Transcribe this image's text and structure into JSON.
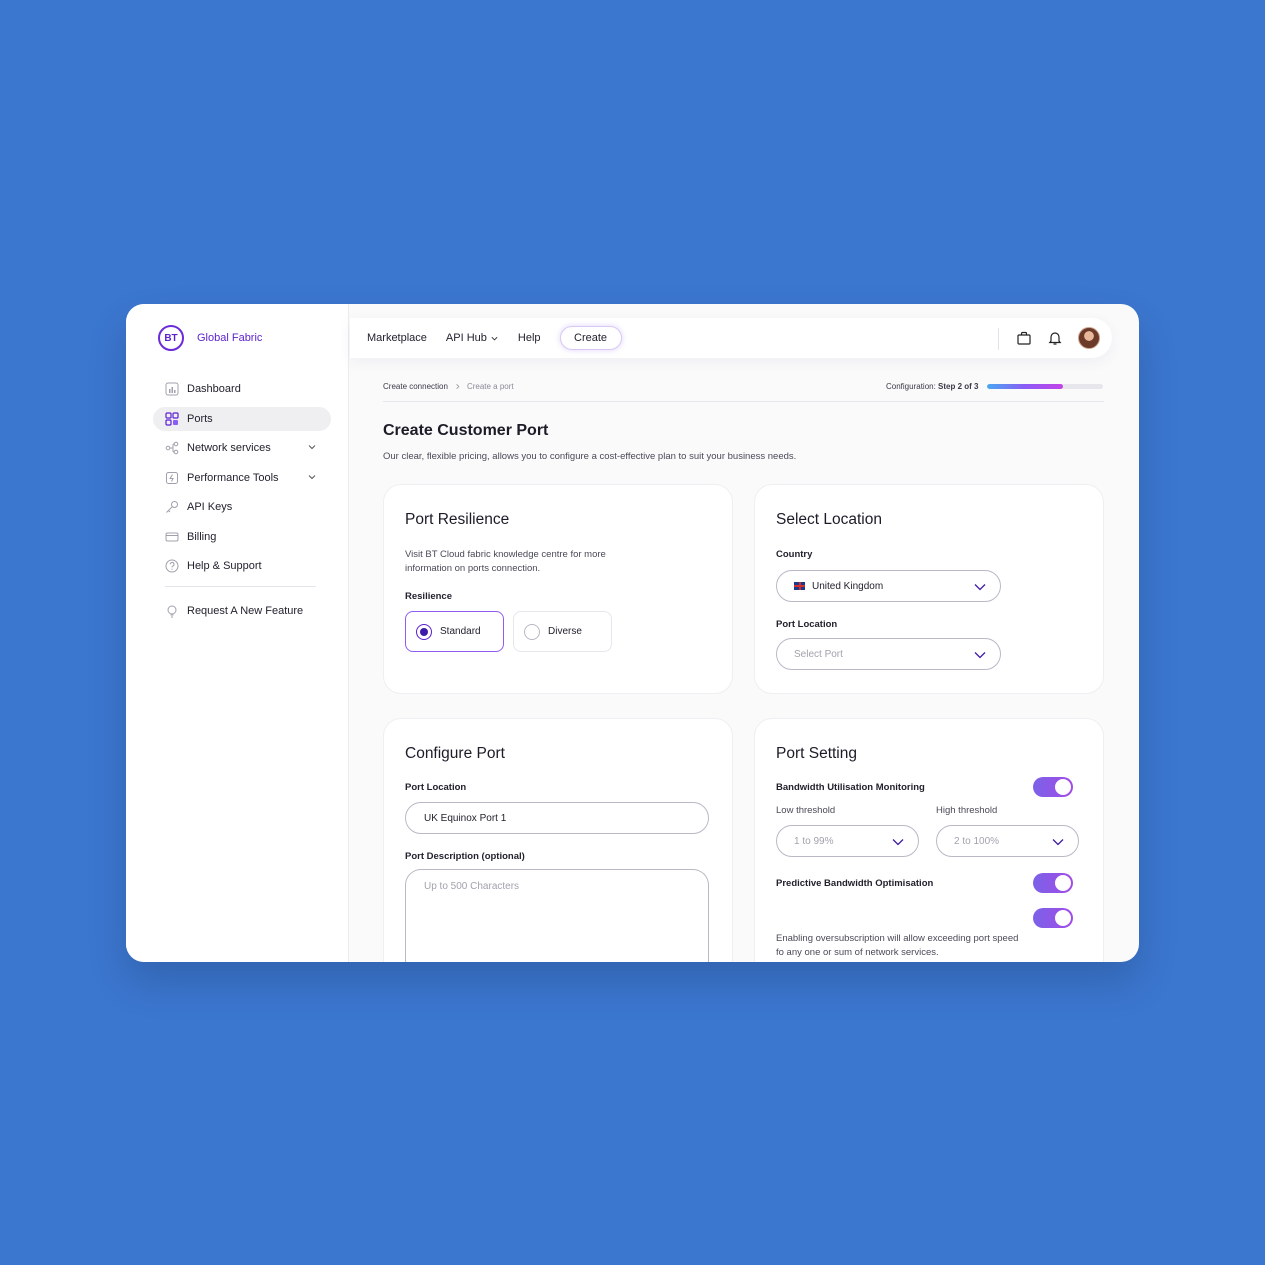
{
  "brand": {
    "logo_text": "BT",
    "name": "Global Fabric"
  },
  "sidebar": {
    "items": [
      {
        "label": "Dashboard"
      },
      {
        "label": "Ports"
      },
      {
        "label": "Network services"
      },
      {
        "label": "Performance Tools"
      },
      {
        "label": "API Keys"
      },
      {
        "label": "Billing"
      },
      {
        "label": "Help & Support"
      }
    ],
    "request_feature": "Request A New Feature",
    "active": "Ports"
  },
  "topnav": {
    "marketplace": "Marketplace",
    "api_hub": "API Hub",
    "help": "Help",
    "create": "Create"
  },
  "breadcrumb": {
    "first": "Create connection",
    "current": "Create a port"
  },
  "progress": {
    "label": "Configuration:",
    "step": "Step 2 of 3",
    "fraction": 0.66
  },
  "page": {
    "title": "Create Customer Port",
    "subtitle": "Our clear, flexible pricing, allows you to configure a cost-effective plan to suit your business needs."
  },
  "resilience_card": {
    "title": "Port Resilience",
    "info": "Visit BT Cloud fabric knowledge centre for more information on ports connection.",
    "label": "Resilience",
    "options": [
      "Standard",
      "Diverse"
    ],
    "selected": "Standard"
  },
  "location_card": {
    "title": "Select Location",
    "country_label": "Country",
    "country_value": "United Kingdom",
    "port_location_label": "Port Location",
    "port_location_placeholder": "Select Port"
  },
  "configure_card": {
    "title": "Configure Port",
    "port_location_label": "Port Location",
    "port_location_value": "UK Equinox Port 1",
    "description_label": "Port Description (optional)",
    "description_placeholder": "Up to 500 Characters"
  },
  "setting_card": {
    "title": "Port Setting",
    "bandwidth_label": "Bandwidth Utilisation Monitoring",
    "bandwidth_on": true,
    "low_label": "Low threshold",
    "low_placeholder": "1 to 99%",
    "high_label": "High threshold",
    "high_placeholder": "2 to 100%",
    "predictive_label": "Predictive Bandwidth Optimisation",
    "predictive_on": true,
    "oversub_on": true,
    "oversub_text": "Enabling oversubscription will allow exceeding port speed fo any one or sum of network services."
  },
  "colors": {
    "background": "#3b76cf",
    "accent": "#5a1fcf",
    "toggle": "#8b5cf6"
  }
}
